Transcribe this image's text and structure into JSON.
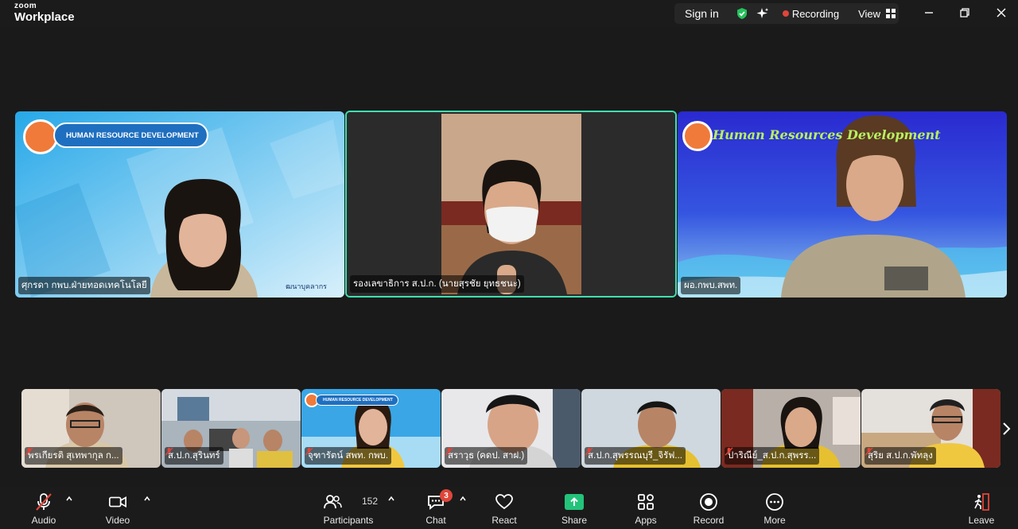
{
  "app": {
    "brand_small": "zoom",
    "brand_big": "Workplace"
  },
  "titlebar": {
    "sign_in": "Sign in",
    "recording": "Recording",
    "view": "View"
  },
  "speakers": [
    {
      "name": "ศุกรดา กพบ.ฝ่ายทอดเทคโนโลยี",
      "banner": "HUMAN RESOURCE DEVELOPMENT",
      "corner_text": "ฒนาบุคลากร"
    },
    {
      "name": "รองเลขาธิการ ส.ป.ก. (นายสุรชัย ยุทธชนะ)"
    },
    {
      "name": "ผอ.กพบ.สพท.",
      "banner": "Human Resources Development"
    }
  ],
  "gallery": [
    {
      "name": "พรเกียรติ สุเทพากุล ก..."
    },
    {
      "name": "ส.ป.ก.สุรินทร์"
    },
    {
      "name": "จุฑารัตน์ สพท. กพบ.",
      "banner": "HUMAN RESOURCE DEVELOPMENT"
    },
    {
      "name": "สราวุธ (คดป. สาฝ.)"
    },
    {
      "name": "ส.ป.ก.สุพรรณบุรี_จิรัฟ..."
    },
    {
      "name": "ปาริณีย์_ส.ป.ก.สุพรร..."
    },
    {
      "name": "สุริย ส.ป.ก.พัทลุง"
    }
  ],
  "toolbar": {
    "audio": "Audio",
    "video": "Video",
    "participants": "Participants",
    "participant_count": "152",
    "chat": "Chat",
    "chat_badge": "3",
    "react": "React",
    "share": "Share",
    "apps": "Apps",
    "record": "Record",
    "more": "More",
    "leave": "Leave"
  },
  "colors": {
    "active_speaker_border": "#3de0b0",
    "recording_dot": "#e0453a",
    "share_green": "#23c37a",
    "verified_green": "#25c25c"
  }
}
